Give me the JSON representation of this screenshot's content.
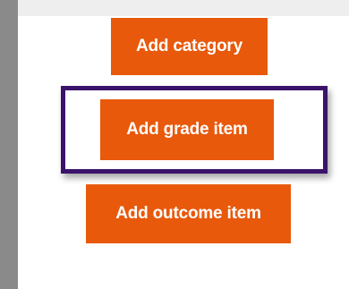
{
  "buttons": {
    "add_category": "Add category",
    "add_grade_item": "Add grade item",
    "add_outcome_item": "Add outcome item"
  },
  "colors": {
    "button_background": "#e8590c",
    "button_text": "#ffffff",
    "highlight_border": "#3b136b",
    "page_background": "#ffffff",
    "outer_background": "#8a8a8a"
  }
}
